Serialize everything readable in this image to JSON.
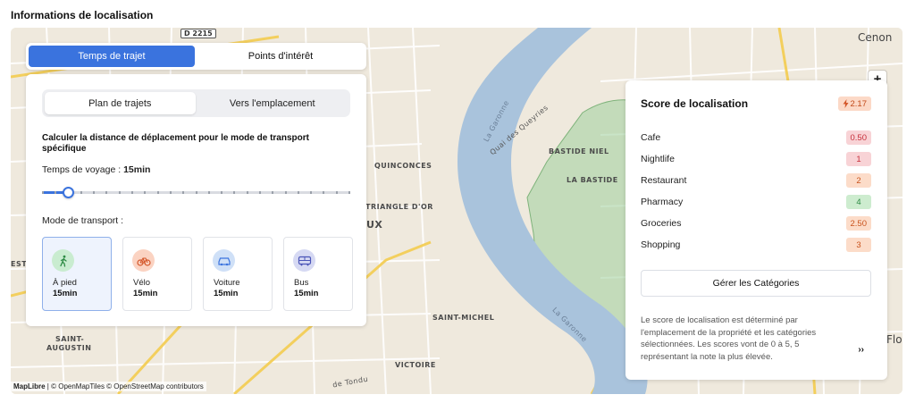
{
  "section_title": "Informations de localisation",
  "map": {
    "labels": {
      "cenon": "Cenon",
      "flo": "Flo",
      "quinconces": "QUINCONCES",
      "bastide_niel": "BASTIDE NIEL",
      "la_bastide": "LA BASTIDE",
      "saint_michel": "SAINT-MICHEL",
      "victoire": "VICTOIRE",
      "saint": "SAINT-",
      "augustin": "AUGUSTIN",
      "triangle_dor": "TRIANGLE D'OR",
      "ux": "UX",
      "esti": "ESTI",
      "quai": "Quai des Queyries",
      "garonne1": "La Garonne",
      "garonne2": "La Garonne",
      "tondu": "de Tondu"
    },
    "road_shield": "D 2215",
    "zoom_in": "+",
    "zoom_out": "−",
    "attribution_brand": "MapLibre",
    "attribution_rest": "| © OpenMapTiles © OpenStreetMap contributors"
  },
  "main_tabs": [
    {
      "label": "Temps de trajet",
      "active": true
    },
    {
      "label": "Points d'intérêt",
      "active": false
    }
  ],
  "sub_tabs": [
    {
      "label": "Plan de trajets",
      "active": true
    },
    {
      "label": "Vers l'emplacement",
      "active": false
    }
  ],
  "calc_title": "Calculer la distance de déplacement pour le mode de transport spécifique",
  "travel": {
    "label": "Temps de voyage : ",
    "value": "15min",
    "slider_fraction": 0.085
  },
  "mode_label": "Mode de transport :",
  "modes": [
    {
      "name": "À pied",
      "time": "15min",
      "icon": "walking-icon",
      "active": true,
      "icon_bg": "#c9ecd0",
      "icon_color": "#2e8b45"
    },
    {
      "name": "Vélo",
      "time": "15min",
      "icon": "bike-icon",
      "active": false,
      "icon_bg": "#fbd3c2",
      "icon_color": "#d4572a"
    },
    {
      "name": "Voiture",
      "time": "15min",
      "icon": "car-icon",
      "active": false,
      "icon_bg": "#cfe0f7",
      "icon_color": "#3a73de"
    },
    {
      "name": "Bus",
      "time": "15min",
      "icon": "bus-icon",
      "active": false,
      "icon_bg": "#d6d9f3",
      "icon_color": "#4b55b8"
    }
  ],
  "score": {
    "title": "Score de localisation",
    "total": "2.17",
    "categories": [
      {
        "name": "Cafe",
        "value": "0.50",
        "bg": "#f8d3d6",
        "fg": "#c62f3b"
      },
      {
        "name": "Nightlife",
        "value": "1",
        "bg": "#f8d3d6",
        "fg": "#c62f3b"
      },
      {
        "name": "Restaurant",
        "value": "2",
        "bg": "#fcdcc9",
        "fg": "#c9531d"
      },
      {
        "name": "Pharmacy",
        "value": "4",
        "bg": "#cdeccf",
        "fg": "#2e8b45"
      },
      {
        "name": "Groceries",
        "value": "2.50",
        "bg": "#fcdcc9",
        "fg": "#c9531d"
      },
      {
        "name": "Shopping",
        "value": "3",
        "bg": "#fcdcc9",
        "fg": "#c9531d"
      }
    ],
    "manage_label": "Gérer les Catégories",
    "description": "Le score de localisation est déterminé par l'emplacement de la propriété et les catégories sélectionnées. Les scores vont de 0 à 5, 5 représentant la note la plus élevée.",
    "more_label": "››"
  }
}
